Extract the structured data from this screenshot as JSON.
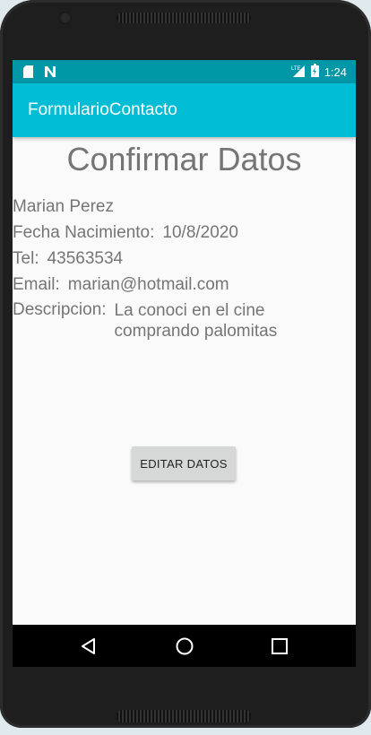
{
  "status": {
    "time": "1:24",
    "network": "LTE"
  },
  "appbar": {
    "title": "FormularioContacto"
  },
  "main": {
    "title": "Confirmar Datos",
    "name": "Marian Perez",
    "birth": {
      "label": "Fecha Nacimiento:",
      "value": "10/8/2020"
    },
    "phone": {
      "label": "Tel:",
      "value": "43563534"
    },
    "email": {
      "label": "Email:",
      "value": "marian@hotmail.com"
    },
    "description": {
      "label": "Descripcion:",
      "value": "La conoci en el cine comprando palomitas"
    },
    "edit_button": "EDITAR DATOS"
  },
  "colors": {
    "status_bar": "#0097a7",
    "app_bar": "#00bcd4",
    "text": "#757575",
    "button": "#d6d7d7"
  },
  "icons": [
    "sd-card-icon",
    "n-notification-icon",
    "lte-signal-icon",
    "battery-icon",
    "back-icon",
    "home-icon",
    "recents-icon"
  ]
}
